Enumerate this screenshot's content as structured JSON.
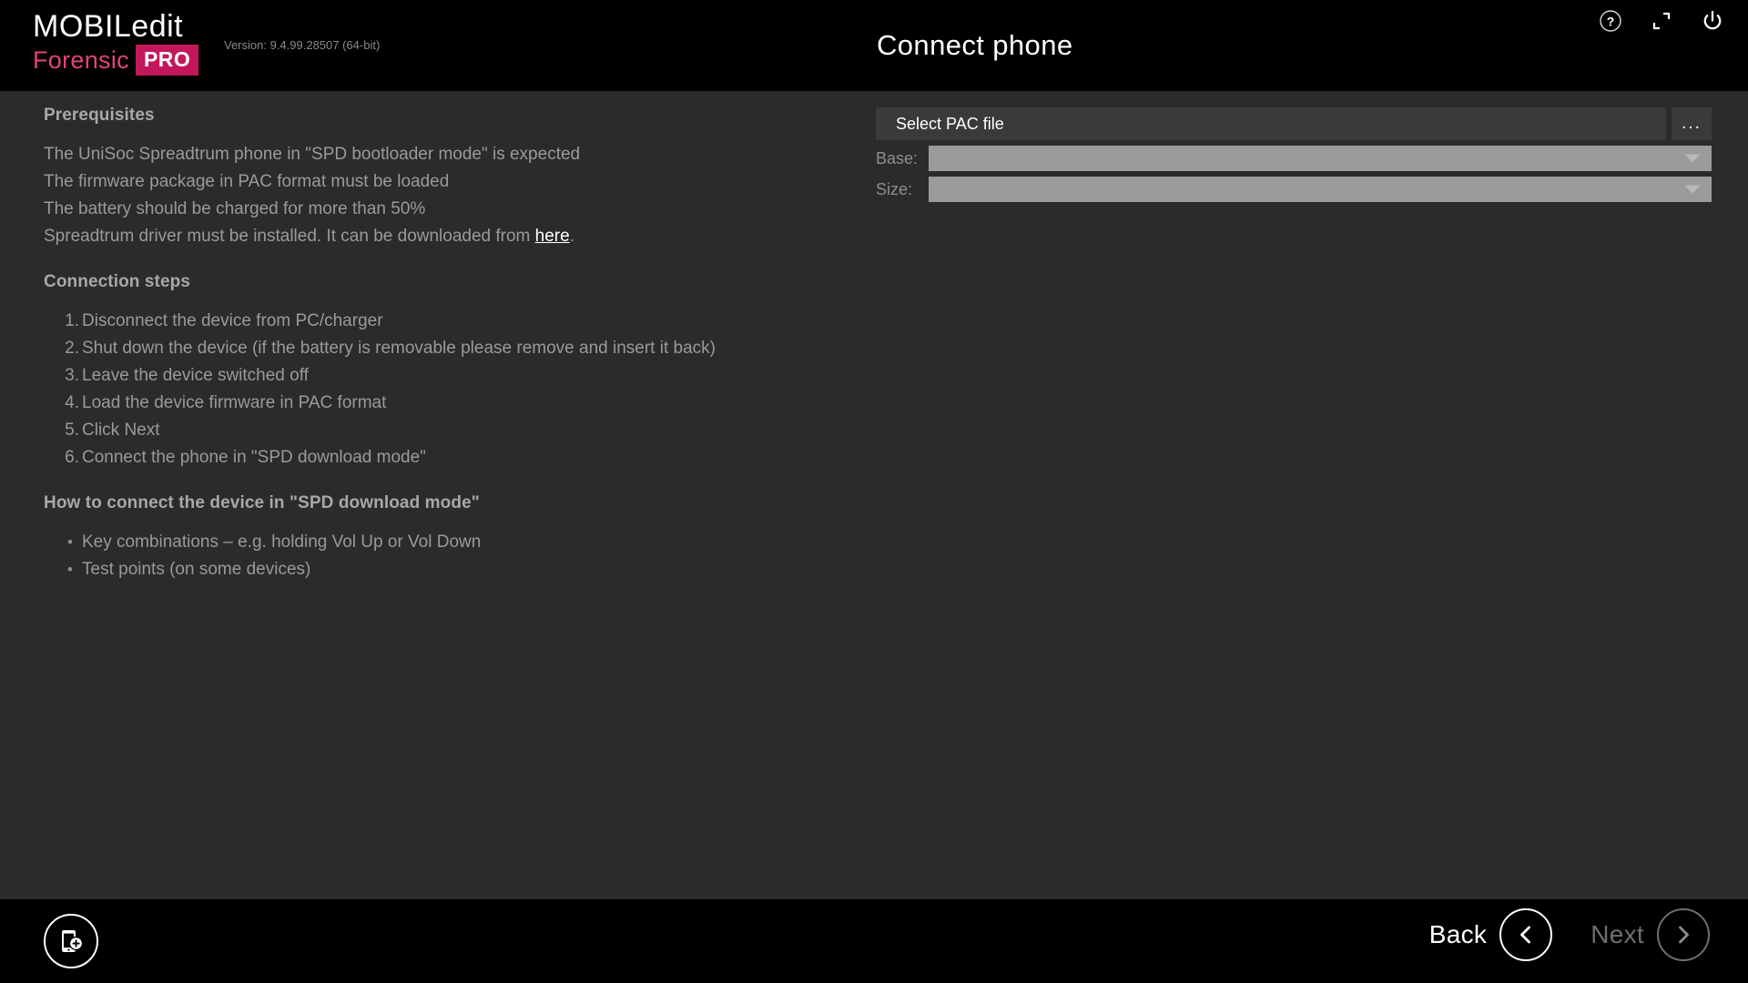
{
  "app": {
    "brand_line1": "MOBILedit",
    "brand_forensic": "Forensic",
    "brand_pro": "PRO",
    "version": "Version: 9.4.99.28507 (64-bit)",
    "page_title": "Connect phone",
    "accent_pink": "#c2185b",
    "accent_rose": "#e0447c",
    "body_bg": "#2b2b2b",
    "bar_bg": "#000000"
  },
  "titlebar": {
    "help_icon": "help-circle-icon",
    "restore_icon": "restore-down-icon",
    "power_icon": "power-icon"
  },
  "instructions": {
    "prerequisites_heading": "Prerequisites",
    "prerequisites": [
      "The UniSoc Spreadtrum phone in \"SPD bootloader mode\" is expected",
      "The firmware package in PAC format must be loaded",
      "The battery should be charged for more than 50%"
    ],
    "driver_text_before": "Spreadtrum driver must be installed. It can be downloaded from ",
    "driver_link": "here",
    "driver_text_after": ".",
    "steps_heading": "Connection steps",
    "steps": [
      "Disconnect the device from PC/charger",
      "Shut down the device (if the battery is removable please remove and insert it back)",
      "Leave the device switched off",
      "Load the device firmware in PAC format",
      "Click Next",
      "Connect the phone in \"SPD download mode\""
    ],
    "howto_heading": "How to connect the device in \"SPD download mode\"",
    "howto_bullets": [
      "Key combinations – e.g. holding Vol Up or Vol Down",
      "Test points (on some devices)"
    ]
  },
  "form": {
    "pac_file_value": "Select PAC file",
    "pac_file_placeholder": "Select PAC file",
    "browse_label": "...",
    "base_label": "Base:",
    "base_value": "",
    "size_label": "Size:",
    "size_value": ""
  },
  "footer": {
    "add_device_icon": "add-device-icon",
    "back_label": "Back",
    "next_label": "Next",
    "back_enabled": "true",
    "next_enabled": "false"
  }
}
